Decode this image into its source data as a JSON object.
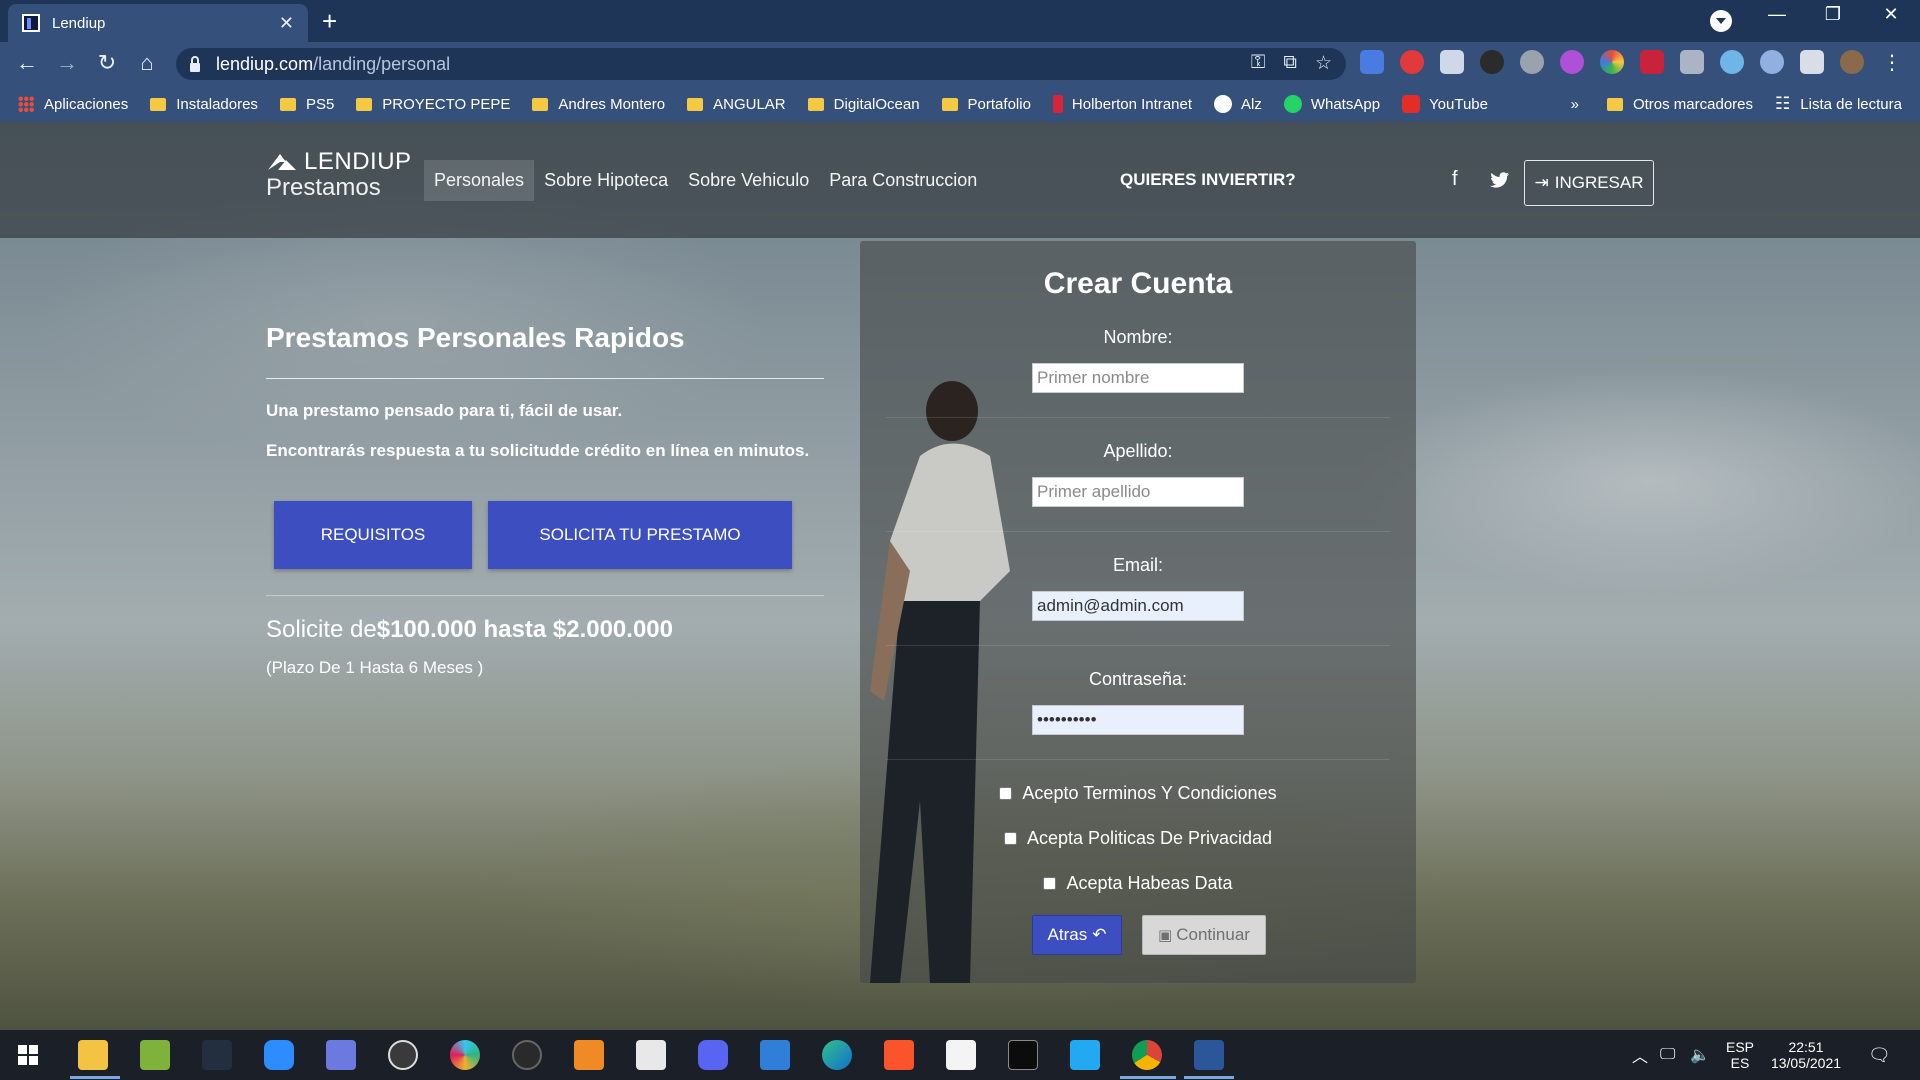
{
  "browser": {
    "tab_title": "Lendiup",
    "tab_close": "✕",
    "new_tab": "+",
    "url_host": "lendiup.com",
    "url_path": "/landing/personal",
    "window_controls": [
      "—",
      "❐",
      "✕"
    ],
    "bookmarks": [
      {
        "label": "Aplicaciones",
        "icon": "apps-grid-icon"
      },
      {
        "label": "Instaladores",
        "icon": "folder-icon"
      },
      {
        "label": "PS5",
        "icon": "folder-icon"
      },
      {
        "label": "PROYECTO PEPE",
        "icon": "folder-icon"
      },
      {
        "label": "Andres Montero",
        "icon": "folder-icon"
      },
      {
        "label": "ANGULAR",
        "icon": "folder-icon"
      },
      {
        "label": "DigitalOcean",
        "icon": "folder-icon"
      },
      {
        "label": "Portafolio",
        "icon": "folder-icon"
      },
      {
        "label": "Holberton Intranet",
        "icon": "holberton-icon"
      },
      {
        "label": "Alz",
        "icon": "github-icon"
      },
      {
        "label": "WhatsApp",
        "icon": "whatsapp-icon"
      },
      {
        "label": "YouTube",
        "icon": "youtube-icon"
      }
    ],
    "bookmarks_overflow": "»",
    "other_bookmarks": "Otros marcadores",
    "reading_list": "Lista de lectura"
  },
  "site": {
    "brand_name": "LENDIUP",
    "brand_sub": "Prestamos",
    "nav": [
      {
        "label": "Personales",
        "active": true
      },
      {
        "label": "Sobre Hipoteca",
        "active": false
      },
      {
        "label": "Sobre Vehiculo",
        "active": false
      },
      {
        "label": "Para Construccion",
        "active": false
      }
    ],
    "invest_link": "QUIERES INVIERTIR?",
    "login_label": "INGRESAR"
  },
  "hero": {
    "title": "Prestamos Personales Rapidos",
    "line1": "Una prestamo pensado para ti, fácil de usar.",
    "line2": "Encontrarás respuesta a tu solicitudde crédito en línea en minutos.",
    "btn_requirements": "REQUISITOS",
    "btn_apply": "SOLICITA TU PRESTAMO",
    "amount_prefix": "Solicite de",
    "amount_range": "$100.000 hasta $2.000.000",
    "term": "(Plazo De 1 Hasta 6 Meses )"
  },
  "form": {
    "title": "Crear Cuenta",
    "first_name_label": "Nombre:",
    "first_name_placeholder": "Primer nombre",
    "last_name_label": "Apellido:",
    "last_name_placeholder": "Primer apellido",
    "email_label": "Email:",
    "email_value": "admin@admin.com",
    "password_label": "Contraseña:",
    "password_value": "••••••••••",
    "checks": [
      "Acepto Terminos Y Condiciones",
      "Acepta Politicas De Privacidad",
      "Acepta Habeas Data"
    ],
    "back_label": "Atras",
    "continue_label": "Continuar"
  },
  "taskbar": {
    "lang_top": "ESP",
    "lang_bottom": "ES",
    "time": "22:51",
    "date": "13/05/2021"
  },
  "colors": {
    "browser_dark": "#1e3557",
    "browser_mid": "#35507a",
    "primary_button": "#3d4fc0",
    "folder": "#f5c942"
  }
}
